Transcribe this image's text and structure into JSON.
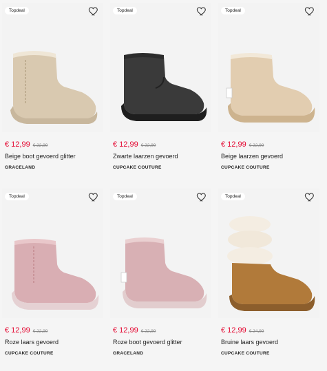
{
  "products": [
    {
      "badge": "Topdeal",
      "price": "€ 12,99",
      "old_price": "€ 22,99",
      "name": "Beige boot gevoerd glitter",
      "brand": "GRACELAND",
      "color": "#d9c9b0",
      "fur": "#efe6d6",
      "sole": "#c8b79d"
    },
    {
      "badge": "Topdeal",
      "price": "€ 12,99",
      "old_price": "€ 22,99",
      "name": "Zwarte laarzen gevoerd",
      "brand": "CUPCAKE COUTURE",
      "color": "#3a3a3a",
      "fur": "#2c2c2c",
      "sole": "#1e1e1e"
    },
    {
      "badge": "Topdeal",
      "price": "€ 12,99",
      "old_price": "€ 22,99",
      "name": "Beige laarzen gevoerd",
      "brand": "CUPCAKE COUTURE",
      "color": "#e2cdb0",
      "fur": "#f2e8d8",
      "sole": "#cdb38e"
    },
    {
      "badge": "Topdeal",
      "price": "€ 12,99",
      "old_price": "€ 22,99",
      "name": "Roze laars gevoerd",
      "brand": "CUPCAKE COUTURE",
      "color": "#d9aeb3",
      "fur": "#e9c7ca",
      "sole": "#e5d1d3"
    },
    {
      "badge": "Topdeal",
      "price": "€ 12,99",
      "old_price": "€ 22,99",
      "name": "Roze boot gevoerd glitter",
      "brand": "GRACELAND",
      "color": "#d8b0b4",
      "fur": "#ead0d1",
      "sole": "#e2cdce"
    },
    {
      "badge": "Topdeal",
      "price": "€ 12,99",
      "old_price": "€ 24,99",
      "name": "Bruine laars gevoerd",
      "brand": "CUPCAKE COUTURE",
      "color": "#b17a3a",
      "fur": "#f4ede2",
      "sole": "#8c5e2c"
    }
  ],
  "icons": {
    "favorite": "heart-outline-icon"
  }
}
